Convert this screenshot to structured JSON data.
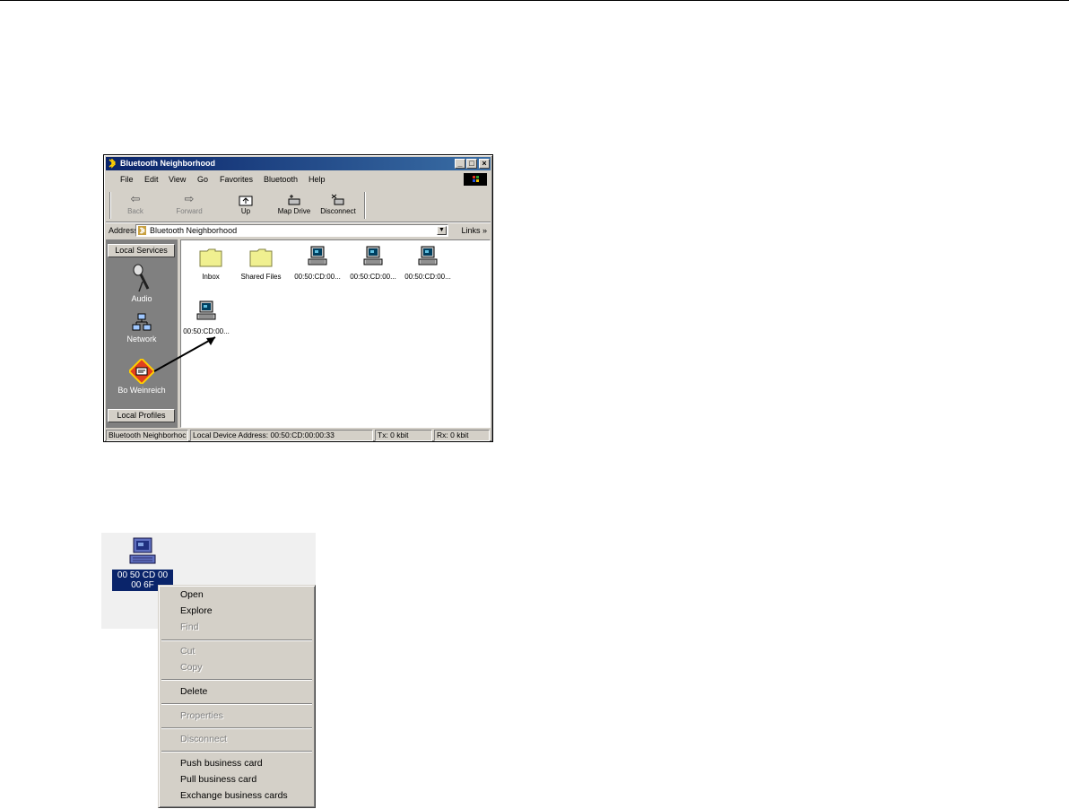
{
  "window": {
    "title": "Bluetooth Neighborhood",
    "menu": [
      "File",
      "Edit",
      "View",
      "Go",
      "Favorites",
      "Bluetooth",
      "Help"
    ],
    "toolbar": {
      "back": "Back",
      "forward": "Forward",
      "up": "Up",
      "map_drive": "Map Drive",
      "disconnect": "Disconnect"
    },
    "address": {
      "label": "Address",
      "value": "Bluetooth Neighborhood",
      "links": "Links"
    },
    "sidebar": {
      "top_header": "Local Services",
      "bottom_header": "Local Profiles",
      "items": [
        "Audio",
        "Network",
        "Bo Weinreich"
      ]
    },
    "files": [
      {
        "label": "Inbox",
        "type": "folder"
      },
      {
        "label": "Shared Files",
        "type": "folder"
      },
      {
        "label": "00:50:CD:00...",
        "type": "computer"
      },
      {
        "label": "00:50:CD:00...",
        "type": "computer"
      },
      {
        "label": "00:50:CD:00...",
        "type": "computer"
      },
      {
        "label": "00:50:CD:00...",
        "type": "computer"
      }
    ],
    "status": {
      "path": "Bluetooth Neighborhoc",
      "device_address": "Local Device Address: 00:50:CD:00:00:33",
      "tx": "Tx:   0 kbit",
      "rx": "Rx:   0 kbit"
    }
  },
  "selected_device": {
    "line1": "00 50 CD 00",
    "line2": "00 6F"
  },
  "context_menu": {
    "open": "Open",
    "explore": "Explore",
    "find": "Find",
    "cut": "Cut",
    "copy": "Copy",
    "delete": "Delete",
    "properties": "Properties",
    "disconnect": "Disconnect",
    "push_card": "Push business card",
    "pull_card": "Pull business card",
    "exchange_cards": "Exchange business cards"
  },
  "colors": {
    "title_bar": "#0a246a",
    "face": "#d4d0c8",
    "sidebar": "#808080",
    "selection": "#0a246a"
  }
}
